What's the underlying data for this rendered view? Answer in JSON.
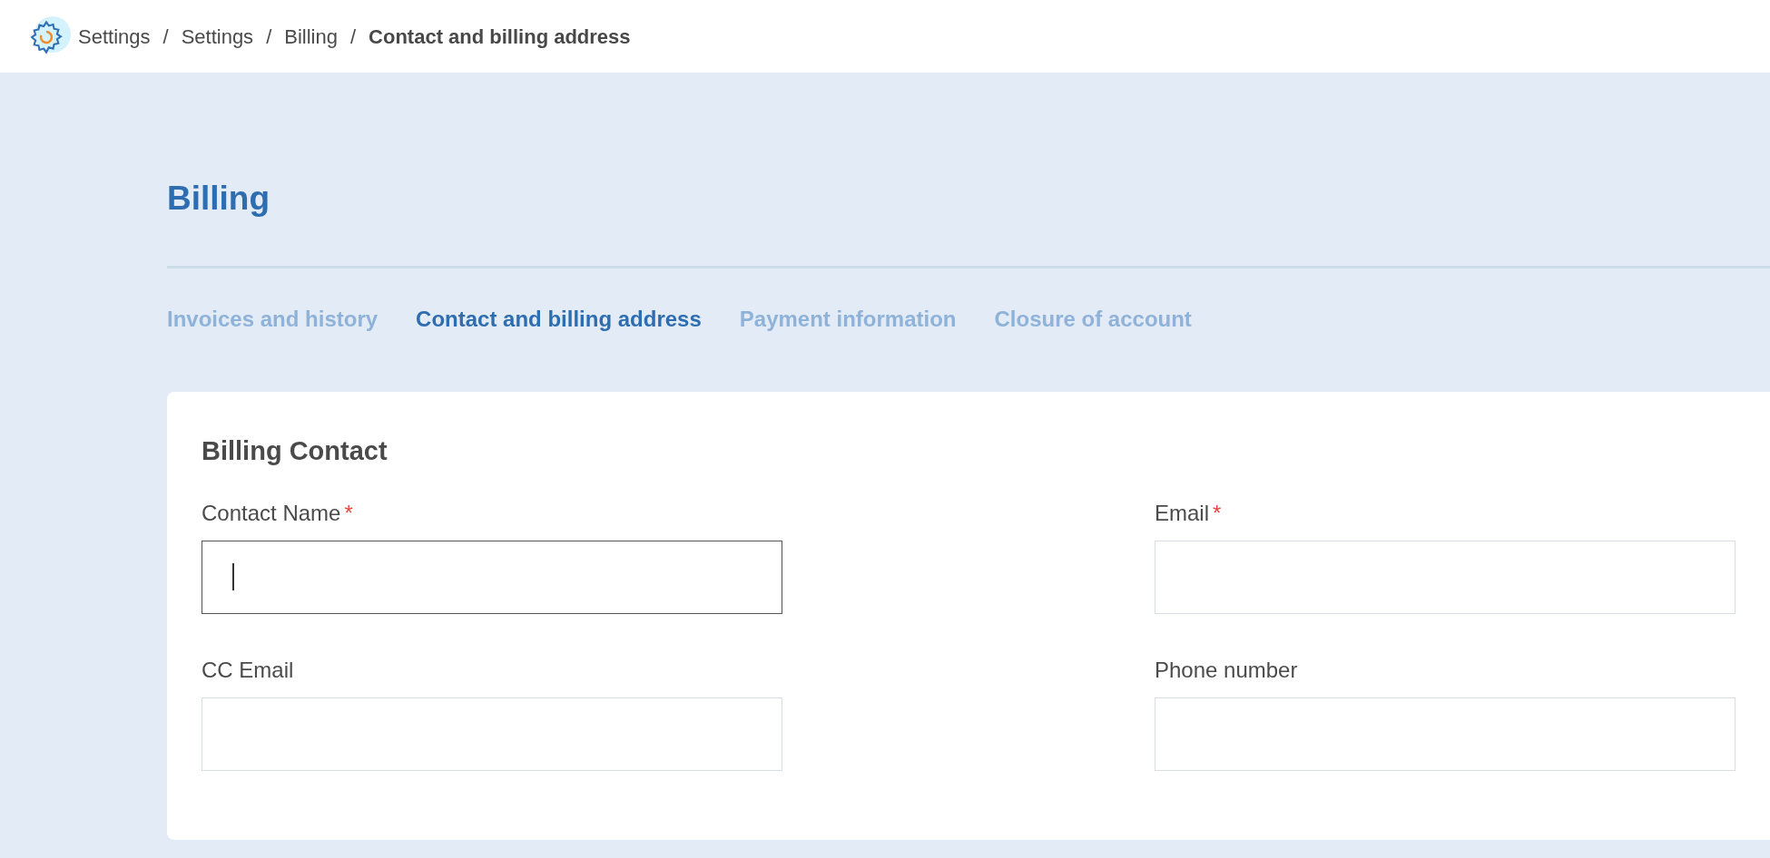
{
  "breadcrumb": [
    {
      "label": "Settings",
      "current": false
    },
    {
      "label": "Settings",
      "current": false
    },
    {
      "label": "Billing",
      "current": false
    },
    {
      "label": "Contact and billing address",
      "current": true
    }
  ],
  "breadcrumb_separator": "/",
  "page_title": "Billing",
  "tabs": [
    {
      "label": "Invoices and history",
      "selected": false
    },
    {
      "label": "Contact and billing address",
      "selected": true
    },
    {
      "label": "Payment information",
      "selected": false
    },
    {
      "label": "Closure of account",
      "selected": false
    }
  ],
  "card": {
    "title": "Billing Contact",
    "required_mark": "*",
    "fields": [
      {
        "label": "Contact Name",
        "required": true,
        "focused": true
      },
      {
        "label": "Email",
        "required": true,
        "focused": false
      },
      {
        "label": "CC Email",
        "required": false,
        "focused": false
      },
      {
        "label": "Phone number",
        "required": false,
        "focused": false
      }
    ]
  }
}
